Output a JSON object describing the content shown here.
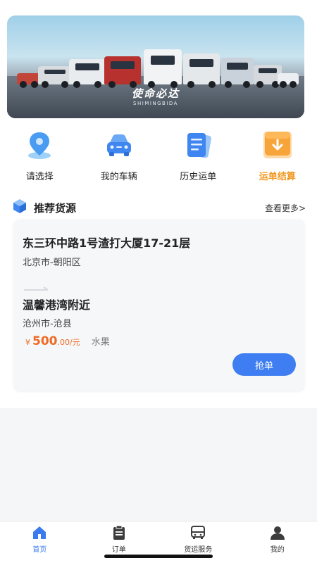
{
  "banner": {
    "slogan": "使命必达",
    "slogan_sub": "SHIMINGBIDA"
  },
  "quick_nav": [
    {
      "label": "请选择",
      "icon": "location-pin-icon"
    },
    {
      "label": "我的车辆",
      "icon": "car-icon"
    },
    {
      "label": "历史运单",
      "icon": "document-list-icon"
    },
    {
      "label": "运单结算",
      "icon": "download-box-icon",
      "accent_color": "#f0961c"
    }
  ],
  "recommend": {
    "title": "推荐货源",
    "more": "查看更多>",
    "icon": "cube-box-icon"
  },
  "cargo": {
    "from_address": "东三环中路1号渣打大厦17-21层",
    "from_city": "北京市-朝阳区",
    "to_address": "温馨港湾附近",
    "to_city": "沧州市-沧县",
    "price_symbol": "¥",
    "price_integer": "500",
    "price_unit": ".00/元",
    "cargo_type": "水果",
    "grab_label": "抢单"
  },
  "tabbar": [
    {
      "label": "首页",
      "icon": "home-icon",
      "active": true
    },
    {
      "label": "订单",
      "icon": "clipboard-icon"
    },
    {
      "label": "货运服务",
      "icon": "bus-icon"
    },
    {
      "label": "我的",
      "icon": "user-icon"
    }
  ],
  "colors": {
    "primary": "#3e7ef2",
    "price": "#ee6b25",
    "accent": "#f0961c"
  }
}
